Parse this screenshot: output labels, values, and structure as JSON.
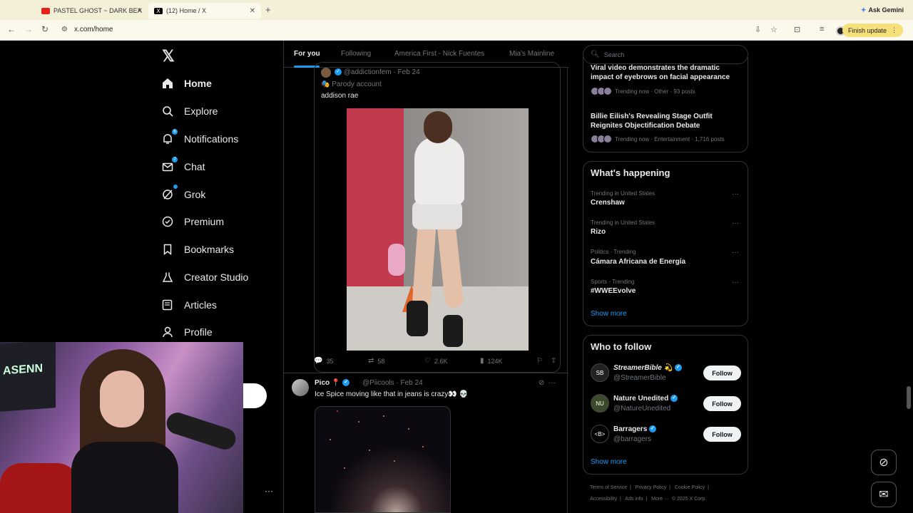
{
  "browser": {
    "tabs": [
      {
        "title": "PASTEL GHOST ~ DARK BEA",
        "favicon_color": "#e62117"
      },
      {
        "title": "(12) Home / X",
        "favicon_color": "#000000"
      }
    ],
    "ask_gemini": "Ask Gemini",
    "url": "x.com/home",
    "finish_update": "Finish update"
  },
  "nav": {
    "logo": "𝕏",
    "items": [
      {
        "label": "Home",
        "icon": "home-icon"
      },
      {
        "label": "Explore",
        "icon": "search-icon"
      },
      {
        "label": "Notifications",
        "icon": "bell-icon",
        "badge": "6"
      },
      {
        "label": "Chat",
        "icon": "mail-icon",
        "badge": "7"
      },
      {
        "label": "Grok",
        "icon": "grok-icon"
      },
      {
        "label": "Premium",
        "icon": "premium-icon"
      },
      {
        "label": "Bookmarks",
        "icon": "bookmark-icon"
      },
      {
        "label": "Creator Studio",
        "icon": "flask-icon"
      },
      {
        "label": "Articles",
        "icon": "articles-icon"
      },
      {
        "label": "Profile",
        "icon": "person-icon"
      }
    ]
  },
  "feed": {
    "tabs": [
      "For you",
      "Following",
      "America First - Nick Fuentes",
      "Mia's Mainline"
    ],
    "quote": {
      "handle": "@addictionfem",
      "date": "Feb 24",
      "parody": "Parody account",
      "text": "addison rae"
    },
    "actions": {
      "replies": "35",
      "reposts": "58",
      "likes": "2.6K",
      "views": "124K"
    },
    "tweet2": {
      "name": "Pico",
      "handle": "@Piicools",
      "date": "Feb 24",
      "text": "Ice Spice moving like that in jeans is crazy👀 💀"
    }
  },
  "right": {
    "search_placeholder": "Search",
    "news": [
      {
        "title": "Viral video demonstrates the dramatic impact of eyebrows on facial appearance",
        "meta": "Trending now · Other · 93 posts"
      },
      {
        "title": "Billie Eilish's Revealing Stage Outfit Reignites Objectification Debate",
        "meta": "Trending now · Entertainment · 1,716 posts"
      }
    ],
    "whats_happening": "What's happening",
    "trends": [
      {
        "meta": "Trending in United States",
        "name": "Crenshaw"
      },
      {
        "meta": "Trending in United States",
        "name": "Rizo"
      },
      {
        "meta": "Politics · Trending",
        "name": "Cámara Africana de Energía"
      },
      {
        "meta": "Sports · Trending",
        "name": "#WWEEvolve"
      }
    ],
    "show_more": "Show more",
    "who_to_follow": "Who to follow",
    "follow_suggestions": [
      {
        "name": "StreamerBible 💫",
        "handle": "@StreamerBible",
        "avatar": "SB"
      },
      {
        "name": "Nature Unedited",
        "handle": "@NatureUnedited",
        "avatar": "NU"
      },
      {
        "name": "Barragers",
        "handle": "@barragers",
        "avatar": "<B>"
      }
    ],
    "follow_label": "Follow",
    "footer_row1": [
      "Terms of Service",
      "Privacy Policy",
      "Cookie Policy"
    ],
    "footer_row2": [
      "Accessibility",
      "Ads info",
      "More ···",
      "© 2025 X Corp."
    ]
  },
  "webcam": {
    "poster_text": "ASENN"
  }
}
